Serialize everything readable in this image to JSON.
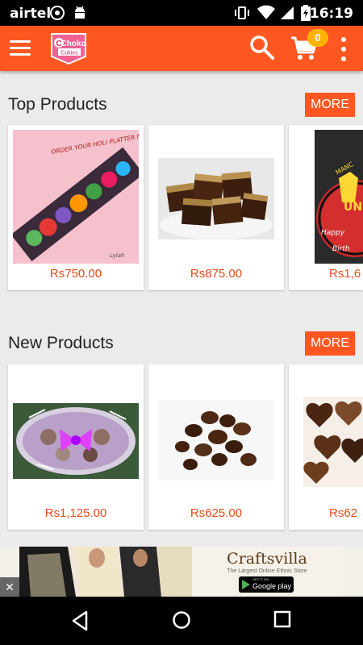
{
  "status_bar": {
    "carrier": "airtel",
    "time": "16:19"
  },
  "app_bar": {
    "logo_text": "Choko",
    "logo_subtext": "Cukies",
    "cart_count": "0"
  },
  "sections": [
    {
      "title": "Top Products",
      "more_label": "MORE",
      "products": [
        {
          "image": "holi-gift-hamper",
          "image_caption": "ORDER YOUR HOLI PLATTER NOW !!",
          "price": "Rs750.00"
        },
        {
          "image": "chocolate-brownies",
          "price": "Rs875.00"
        },
        {
          "image": "manchester-united-cake",
          "price": "Rs1,6"
        }
      ]
    },
    {
      "title": "New Products",
      "more_label": "MORE",
      "products": [
        {
          "image": "chocolate-gift-basket",
          "price": "Rs1,125.00"
        },
        {
          "image": "chocolate-pieces",
          "price": "Rs625.00"
        },
        {
          "image": "heart-chocolates",
          "price": "Rs62"
        }
      ]
    }
  ],
  "ad": {
    "brand": "Craftsvilla",
    "tagline": "The Largest Online Ethnic Store",
    "store_badge_top": "GET IT ON",
    "store_badge": "Google play",
    "close_label": "✕"
  },
  "colors": {
    "primary": "#ff5722",
    "price": "#e64a19",
    "badge": "#ffb300",
    "background": "#ebebeb"
  }
}
